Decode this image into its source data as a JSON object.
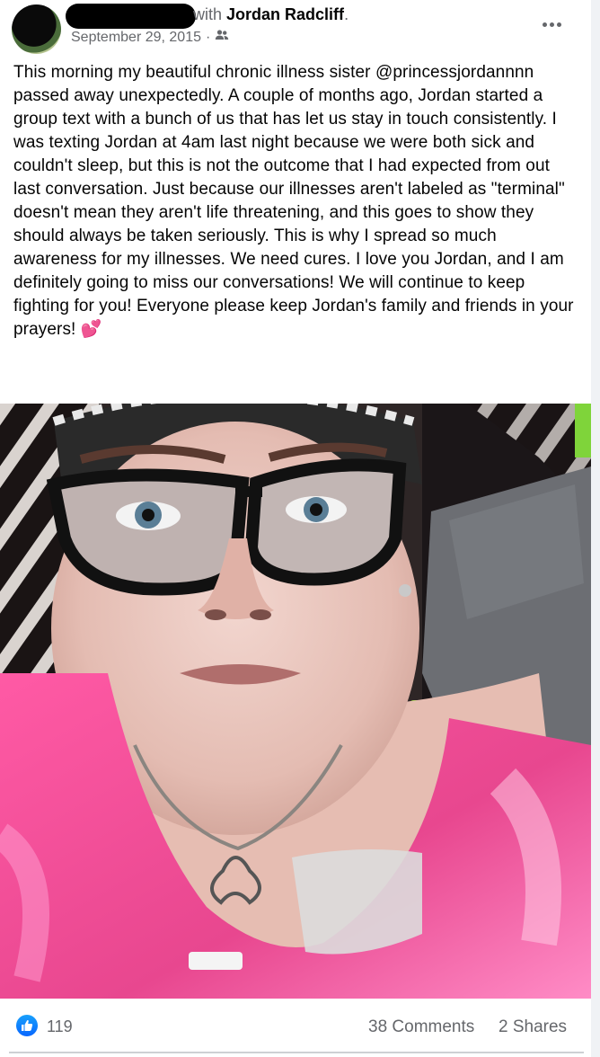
{
  "header": {
    "with_text": "with",
    "tagged_name": "Jordan Radcliff",
    "trailing": ".",
    "date": "September 29, 2015",
    "separator": "·",
    "audience_icon": "friends-icon",
    "more_icon": "more-options-icon"
  },
  "post": {
    "text": "This morning my beautiful chronic illness sister @princessjordannnn passed away unexpectedly. A couple of months ago, Jordan started a group text with a bunch of us that has let us stay in touch consistently. I was texting Jordan at 4am last night because we were both sick and couldn't sleep, but this is not the outcome that I had expected from out last conversation. Just because our illnesses aren't labeled as \"terminal\" doesn't mean they aren't life threatening, and this goes to show they should always be taken seriously. This is why I spread so much awareness for my illnesses. We need cures. I love you Jordan, and I am definitely going to miss our conversations! We will continue to keep fighting for you! Everyone please keep Jordan's family and friends in your prayers!",
    "emoji": "💕"
  },
  "footer": {
    "like_icon": "like-icon",
    "likes": "119",
    "comments": "38 Comments",
    "shares": "2 Shares"
  },
  "colors": {
    "secondary_text": "#65676b",
    "like_blue": "#0866ff",
    "pink_top": "#e8478f"
  }
}
